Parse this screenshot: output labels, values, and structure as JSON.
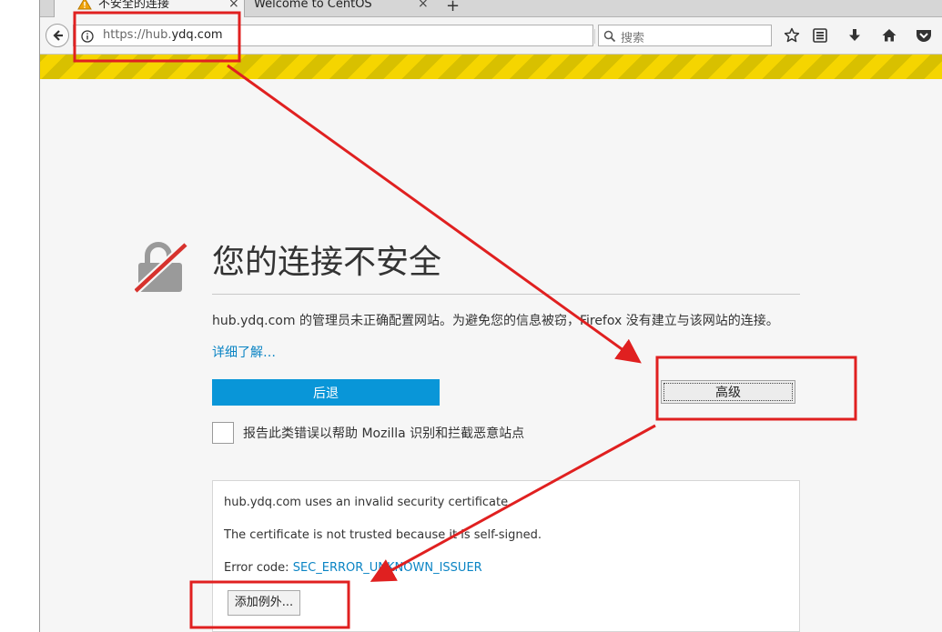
{
  "tabs": [
    {
      "label": "不安全的连接",
      "icon": "warning-icon",
      "active": true
    },
    {
      "label": "Welcome to CentOS",
      "active": false
    }
  ],
  "nav": {
    "url_prefix": "https://hub.",
    "url_domain": "ydq.com",
    "search_placeholder": "搜索"
  },
  "page": {
    "title": "您的连接不安全",
    "description": "hub.ydq.com 的管理员未正确配置网站。为避免您的信息被窃，Firefox 没有建立与该网站的连接。",
    "learn_more": "详细了解…",
    "go_back": "后退",
    "advanced": "高级",
    "report_label": "报告此类错误以帮助 Mozilla 识别和拦截恶意站点",
    "details": {
      "line1": "hub.ydq.com uses an invalid security certificate.",
      "line2": "The certificate is not trusted because it is self-signed.",
      "error_label": "Error code:",
      "error_code": "SEC_ERROR_UNKNOWN_ISSUER",
      "add_exception": "添加例外..."
    }
  },
  "colors": {
    "annotation": "#e02020",
    "primary_button": "#0996d8",
    "link": "#0a84c4",
    "stripe_yellow": "#f5d500"
  }
}
